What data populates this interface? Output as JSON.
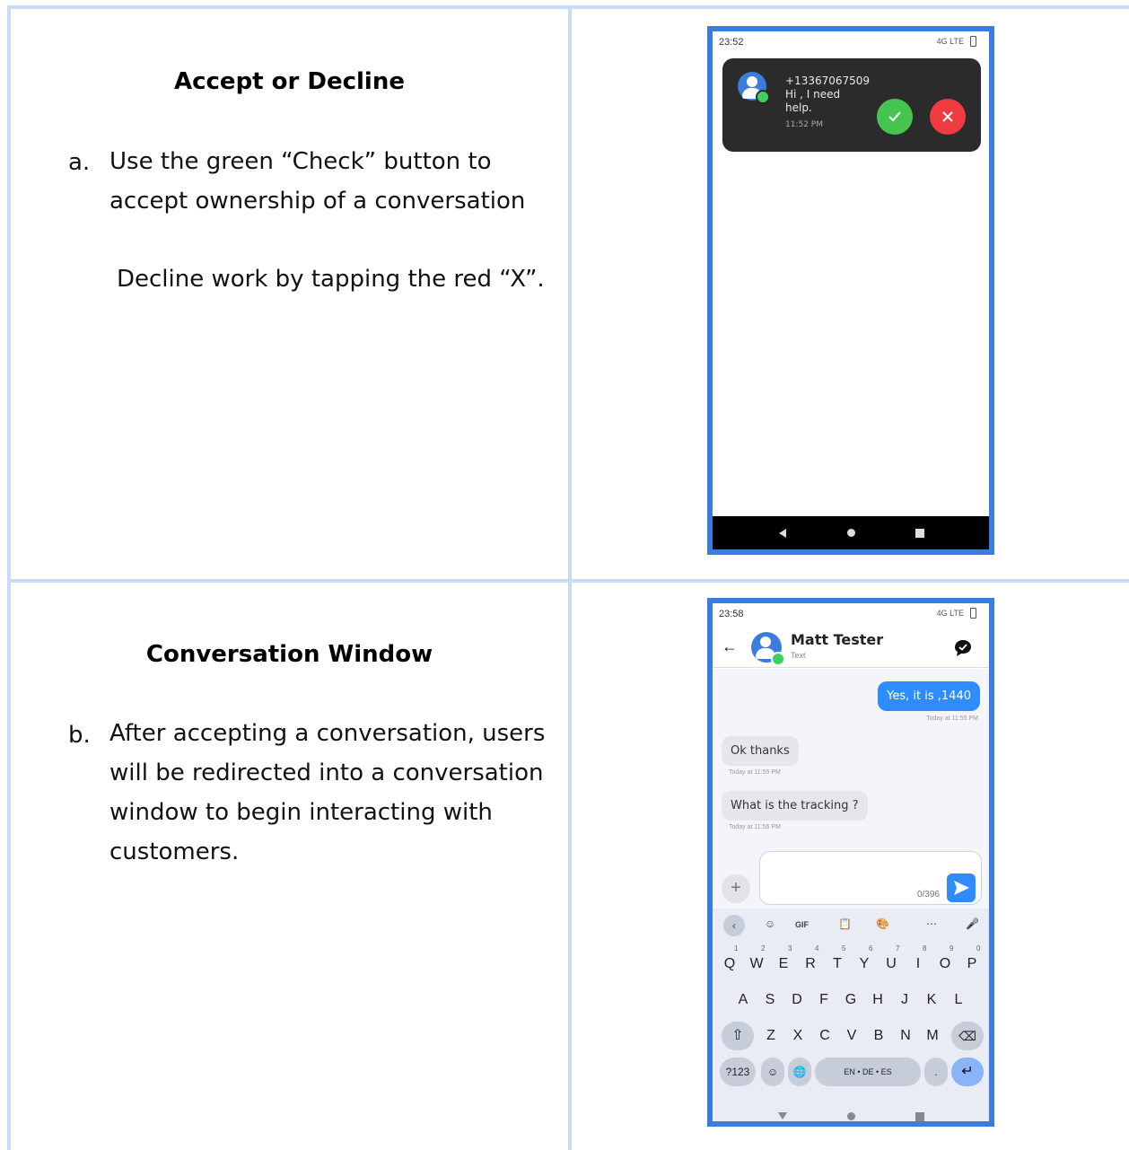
{
  "row1": {
    "heading": "Accept or Decline",
    "marker": "a.",
    "text_line1": "Use the green “Check” button to",
    "text_line2": "accept ownership of a conversation",
    "text_decline": "Decline work by tapping the red “X”.",
    "phone": {
      "status_time": "23:52",
      "status_net": "4G LTE",
      "notification": {
        "phone_number": "+13367067509",
        "message_line1": "Hi , I need",
        "message_line2": "help.",
        "timestamp": "11:52 PM"
      }
    }
  },
  "row2": {
    "heading": "Conversation Window",
    "marker": "b.",
    "text_line1": "After accepting a conversation, users",
    "text_line2": "will be redirected into a conversation",
    "text_line3": "window to begin interacting with",
    "text_line4": "customers.",
    "phone": {
      "status_time": "23:58",
      "status_net": "4G LTE",
      "contact_name": "Matt Tester",
      "contact_channel": "Text",
      "messages": [
        {
          "text": "Yes, it is ,1440",
          "meta": "Today at 11:55 PM"
        },
        {
          "text": "Ok thanks",
          "meta": "Today at 11:55 PM"
        },
        {
          "text": "What is the tracking ?",
          "meta": "Today at 11:56 PM"
        }
      ],
      "counter": "0/396",
      "keyboard": {
        "row1": [
          "Q",
          "W",
          "E",
          "R",
          "T",
          "Y",
          "U",
          "I",
          "O",
          "P"
        ],
        "row1_hints": [
          "1",
          "2",
          "3",
          "4",
          "5",
          "6",
          "7",
          "8",
          "9",
          "0"
        ],
        "row2": [
          "A",
          "S",
          "D",
          "F",
          "G",
          "H",
          "J",
          "K",
          "L"
        ],
        "row3": [
          "Z",
          "X",
          "C",
          "V",
          "B",
          "N",
          "M"
        ],
        "mode_key": "?123",
        "space_label": "EN • DE • ES",
        "gif_label": "GIF",
        "period": "."
      }
    }
  }
}
